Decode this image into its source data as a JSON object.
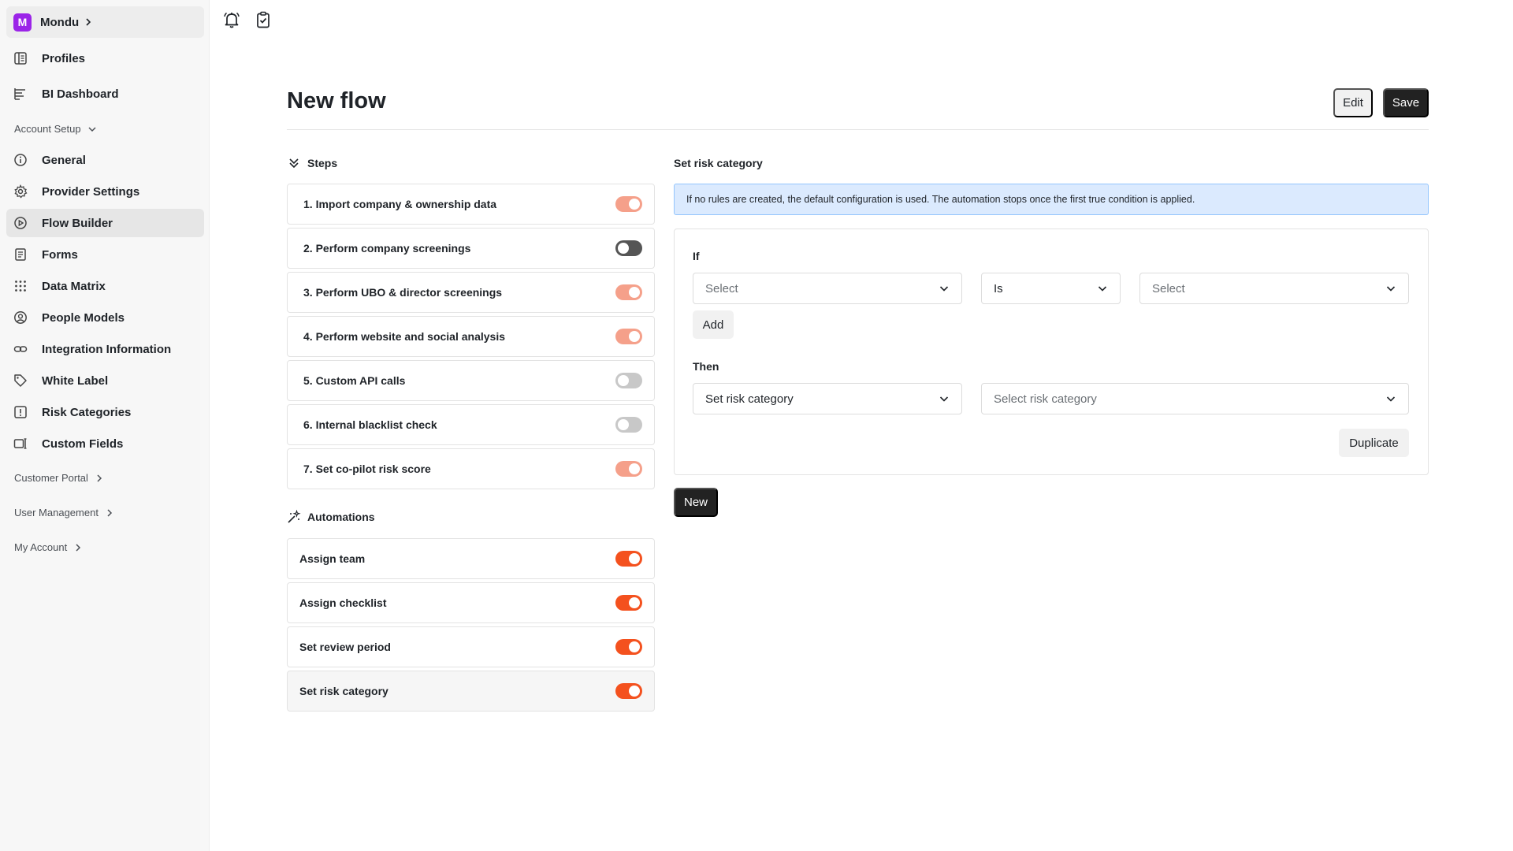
{
  "org": {
    "initial": "M",
    "name": "Mondu"
  },
  "sidebar": {
    "items": [
      {
        "label": "Profiles",
        "icon": "profiles-icon"
      },
      {
        "label": "BI Dashboard",
        "icon": "dashboard-icon"
      },
      {
        "label": "General",
        "icon": "info-icon"
      },
      {
        "label": "Provider Settings",
        "icon": "gear-icon"
      },
      {
        "label": "Flow Builder",
        "icon": "play-circle-icon",
        "active": true
      },
      {
        "label": "Forms",
        "icon": "form-icon"
      },
      {
        "label": "Data Matrix",
        "icon": "grid-dots-icon"
      },
      {
        "label": "People Models",
        "icon": "person-circle-icon"
      },
      {
        "label": "Integration Information",
        "icon": "link-icon"
      },
      {
        "label": "White Label",
        "icon": "tag-icon"
      },
      {
        "label": "Risk Categories",
        "icon": "alert-square-icon"
      },
      {
        "label": "Custom Fields",
        "icon": "custom-fields-icon"
      }
    ],
    "sections": {
      "account_setup": "Account Setup",
      "customer_portal": "Customer Portal",
      "user_management": "User Management",
      "my_account": "My Account"
    }
  },
  "topbar": {
    "icons": [
      "bell-icon",
      "clipboard-check-icon"
    ]
  },
  "page": {
    "title": "New flow",
    "edit_label": "Edit",
    "save_label": "Save"
  },
  "steps": {
    "heading": "Steps",
    "items": [
      {
        "label": "1. Import company & ownership data",
        "enabled": true
      },
      {
        "label": "2. Perform company screenings",
        "enabled": false
      },
      {
        "label": "3. Perform UBO & director screenings",
        "enabled": true
      },
      {
        "label": "4. Perform website and social analysis",
        "enabled": true
      },
      {
        "label": "5. Custom API calls",
        "enabled": false
      },
      {
        "label": "6. Internal blacklist check",
        "enabled": false
      },
      {
        "label": "7. Set co-pilot risk score",
        "enabled": true
      }
    ]
  },
  "automations": {
    "heading": "Automations",
    "items": [
      {
        "label": "Assign team",
        "enabled": true
      },
      {
        "label": "Assign checklist",
        "enabled": true
      },
      {
        "label": "Set review period",
        "enabled": true
      },
      {
        "label": "Set risk category",
        "enabled": true,
        "selected": true
      }
    ]
  },
  "rule_editor": {
    "title": "Set risk category",
    "info": "If no rules are created, the default configuration is used. The automation stops once the first true condition is applied.",
    "if_label": "If",
    "condition_field_placeholder": "Select",
    "operator_value": "Is",
    "condition_value_placeholder": "Select",
    "add_label": "Add",
    "then_label": "Then",
    "action_value": "Set risk category",
    "action_target_placeholder": "Select risk category",
    "duplicate_label": "Duplicate",
    "new_label": "New"
  },
  "colors": {
    "toggle_on": "#f4511e",
    "toggle_on_faded": "#f5a08a",
    "toggle_off_dark": "#555555",
    "toggle_off_light": "#c8c8c8",
    "org_badge": "#9b24e8",
    "info_bg": "#dbeafe",
    "info_border": "#93c5fd",
    "primary_button": "#222222"
  }
}
